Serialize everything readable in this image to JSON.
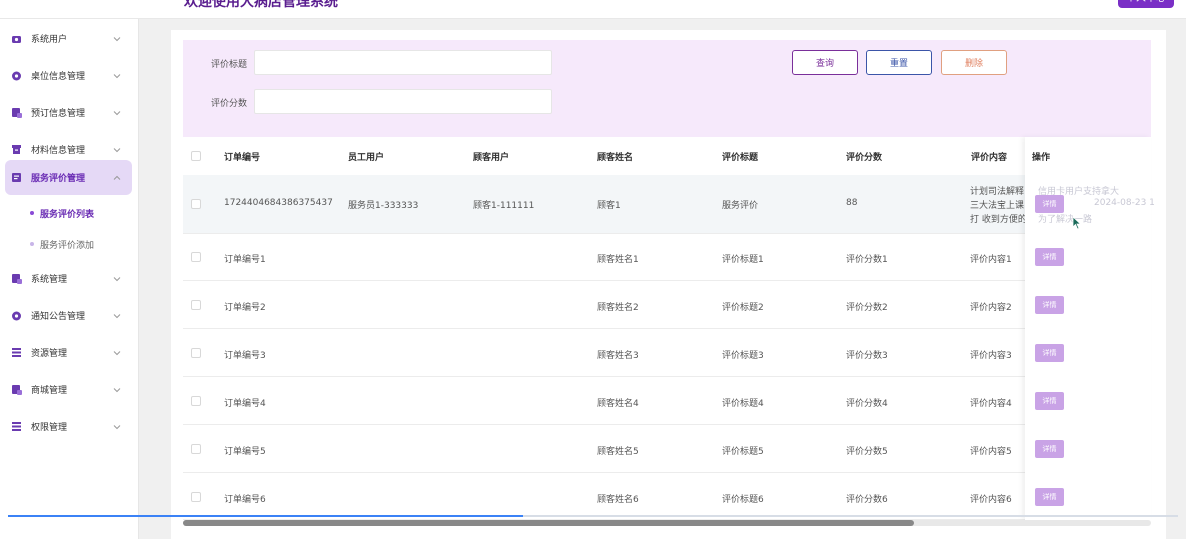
{
  "header": {
    "title": "欢迎使用大病店管理系统",
    "user_badge": "个人中心"
  },
  "sidebar": {
    "items": [
      {
        "label": "系统用户",
        "icon": "users-icon"
      },
      {
        "label": "桌位信息管理",
        "icon": "table-icon"
      },
      {
        "label": "预订信息管理",
        "icon": "calendar-icon"
      },
      {
        "label": "材料信息管理",
        "icon": "box-icon"
      },
      {
        "label": "服务评价管理",
        "icon": "review-icon",
        "active": true
      },
      {
        "label": "系统管理",
        "icon": "settings-icon"
      },
      {
        "label": "通知公告管理",
        "icon": "notice-icon"
      },
      {
        "label": "资源管理",
        "icon": "resource-icon"
      },
      {
        "label": "商城管理",
        "icon": "shop-icon"
      },
      {
        "label": "权限管理",
        "icon": "lock-icon"
      }
    ],
    "sub_items": [
      {
        "label": "服务评价列表",
        "active": true
      },
      {
        "label": "服务评价添加"
      }
    ]
  },
  "search": {
    "title_label": "评价标题",
    "score_label": "评价分数",
    "query_button": "查询",
    "reset_button": "重置",
    "delete_button": "删除"
  },
  "table": {
    "columns": [
      "订单编号",
      "员工用户",
      "顾客用户",
      "顾客姓名",
      "评价标题",
      "评价分数",
      "评价内容",
      "操作"
    ],
    "detail_label": "详情",
    "first_row": {
      "order_no": "1724404684386375437",
      "staff": "服务员1-333333",
      "customer_user": "顾客1-111111",
      "customer_name": "顾客1",
      "title": "服务评价",
      "score": "88",
      "content_lines": [
        "计划司法解释",
        "三大法宝上课",
        "打 收到方便的"
      ],
      "hidden_text_1": "信用卡用户支持拿大",
      "hidden_text_2": "为了解决一路",
      "hidden_date": "2024-08-23 1"
    },
    "rows": [
      {
        "order_no": "订单编号1",
        "customer_name": "顾客姓名1",
        "title": "评价标题1",
        "score": "评价分数1",
        "content": "评价内容1"
      },
      {
        "order_no": "订单编号2",
        "customer_name": "顾客姓名2",
        "title": "评价标题2",
        "score": "评价分数2",
        "content": "评价内容2"
      },
      {
        "order_no": "订单编号3",
        "customer_name": "顾客姓名3",
        "title": "评价标题3",
        "score": "评价分数3",
        "content": "评价内容3"
      },
      {
        "order_no": "订单编号4",
        "customer_name": "顾客姓名4",
        "title": "评价标题4",
        "score": "评价分数4",
        "content": "评价内容4"
      },
      {
        "order_no": "订单编号5",
        "customer_name": "顾客姓名5",
        "title": "评价标题5",
        "score": "评价分数5",
        "content": "评价内容5"
      },
      {
        "order_no": "订单编号6",
        "customer_name": "顾客姓名6",
        "title": "评价标题6",
        "score": "评价分数6",
        "content": "评价内容6"
      }
    ]
  },
  "progress": {
    "fraction": 0.44
  },
  "colors": {
    "accent": "#7a2fc6",
    "search_bg": "#f6e9fb",
    "detail_button": "#c9a3e6"
  }
}
